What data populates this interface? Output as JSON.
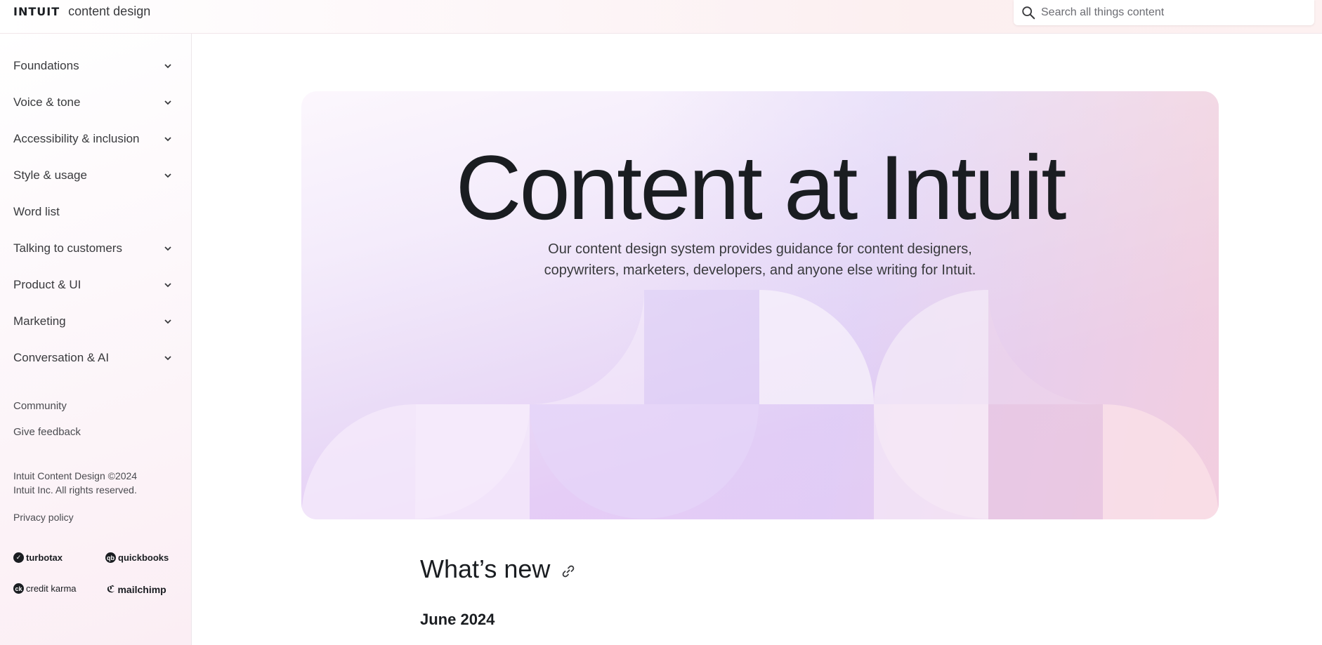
{
  "header": {
    "logo": "INTUIT",
    "subtitle": "content design",
    "search_placeholder": "Search all things content"
  },
  "sidebar": {
    "items": [
      {
        "label": "Foundations",
        "expandable": true
      },
      {
        "label": "Voice & tone",
        "expandable": true
      },
      {
        "label": "Accessibility & inclusion",
        "expandable": true
      },
      {
        "label": "Style & usage",
        "expandable": true
      },
      {
        "label": "Word list",
        "expandable": false
      },
      {
        "label": "Talking to customers",
        "expandable": true
      },
      {
        "label": "Product & UI",
        "expandable": true
      },
      {
        "label": "Marketing",
        "expandable": true
      },
      {
        "label": "Conversation & AI",
        "expandable": true
      }
    ],
    "community": "Community",
    "feedback": "Give feedback",
    "copyright_line1": "Intuit Content Design ©2024",
    "copyright_line2": "Intuit Inc. All rights reserved.",
    "privacy": "Privacy policy",
    "brands": {
      "turbotax": "turbotax",
      "quickbooks": "quickbooks",
      "creditkarma": "credit karma",
      "mailchimp": "mailchimp"
    }
  },
  "hero": {
    "title": "Content at Intuit",
    "description": "Our content design system provides guidance for content designers, copywriters, marketers, developers, and anyone else writing for Intuit."
  },
  "main": {
    "section_title": "What’s new",
    "month": "June 2024"
  },
  "colors": {
    "text": "#1a1d21",
    "secondary_text": "#393a3d",
    "hero_lavender": "#e5cdf6",
    "hero_pink": "#fad0d0"
  }
}
